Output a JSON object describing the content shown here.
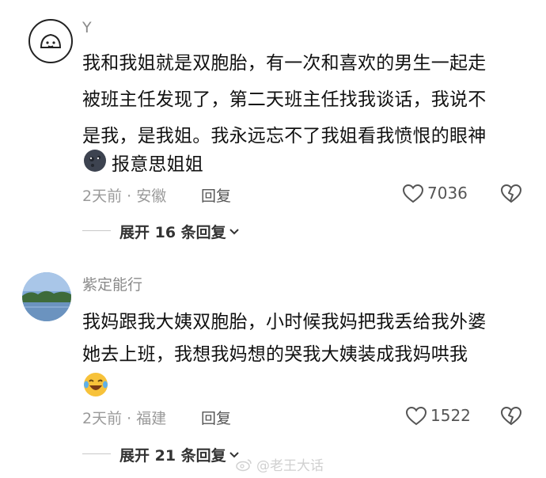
{
  "comments": [
    {
      "username": "Y",
      "lines": [
        "我和我姐就是双胞胎，有一次和喜欢的男生一起走",
        "被班主任发现了，第二天班主任找我谈话，我说不",
        "是我，是我姐。我永远忘不了我姐看我愤恨的眼神"
      ],
      "last_line_text": "报意思姐姐",
      "emoji": "dark-moon-face",
      "time": "2天前",
      "location": "安徽",
      "reply_label": "回复",
      "likes": "7036",
      "expand_label": "展开 16 条回复"
    },
    {
      "username": "紫定能行",
      "lines": [
        "我妈跟我大姨双胞胎，小时候我妈把我丢给我外婆",
        "她去上班，我想我妈想的哭我大姨装成我妈哄我"
      ],
      "emoji": "laughing-crying-face",
      "time": "2天前",
      "location": "福建",
      "reply_label": "回复",
      "likes": "1522",
      "expand_label": "展开 21 条回复"
    }
  ],
  "watermark": "@老王大话",
  "separator": "·"
}
